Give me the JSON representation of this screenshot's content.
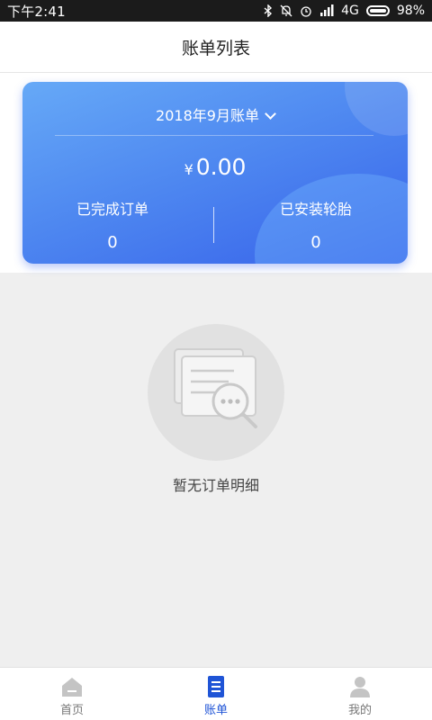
{
  "status_bar": {
    "time": "下午2:41",
    "network": "4G",
    "battery": "98%"
  },
  "header": {
    "title": "账单列表"
  },
  "summary": {
    "month_selector": "2018年9月账单",
    "currency_symbol": "¥",
    "amount": "0.00",
    "stats": [
      {
        "label": "已完成订单",
        "value": "0"
      },
      {
        "label": "已安装轮胎",
        "value": "0"
      }
    ]
  },
  "empty_state": {
    "message": "暂无订单明细"
  },
  "tabbar": {
    "items": [
      {
        "label": "首页",
        "icon": "home-icon"
      },
      {
        "label": "账单",
        "icon": "bill-icon",
        "active": true
      },
      {
        "label": "我的",
        "icon": "user-icon"
      }
    ]
  },
  "colors": {
    "accent": "#1f54d6",
    "card_gradient_start": "#66a9f7",
    "card_gradient_end": "#3762ea"
  }
}
